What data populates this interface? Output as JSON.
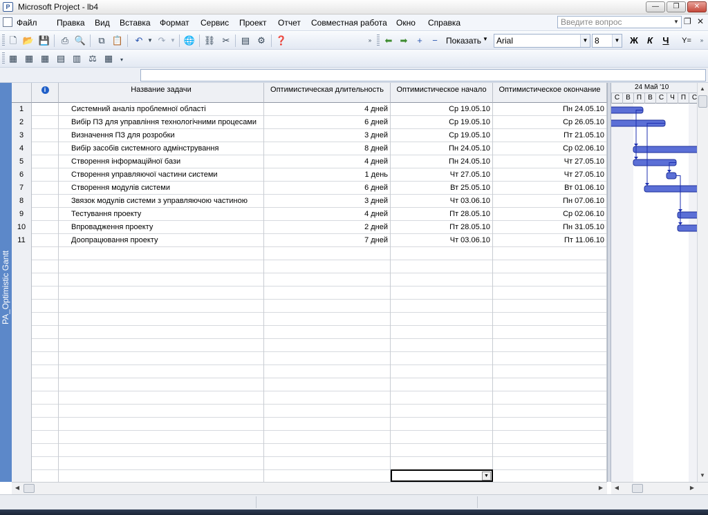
{
  "window": {
    "title": "Microsoft Project - lb4",
    "min_glyph": "—",
    "max_glyph": "❐",
    "close_glyph": "✕"
  },
  "menu": {
    "items": [
      "Файл",
      "Правка",
      "Вид",
      "Вставка",
      "Формат",
      "Сервис",
      "Проект",
      "Отчет",
      "Совместная работа",
      "Окно",
      "Справка"
    ],
    "help_placeholder": "Введите вопрос",
    "doc_restore_glyph": "❐",
    "doc_close_glyph": "✕"
  },
  "toolbar": {
    "show_label": "Показать",
    "font": "Arial",
    "font_size": "8",
    "bold_label": "Ж",
    "italic_label": "К",
    "underline_label": "Ч",
    "filter_label": "Y="
  },
  "view": {
    "label": "PA_Optimistic Gantt"
  },
  "table": {
    "headers": {
      "indicators": "i",
      "name": "Название задачи",
      "duration": "Оптимистическая длительность",
      "start": "Оптимистическое начало",
      "finish": "Оптимистическое окончание"
    },
    "rows": [
      {
        "id": "1",
        "name": "Системний аналіз проблемної області",
        "duration": "4 дней",
        "start": "Ср 19.05.10",
        "finish": "Пн 24.05.10"
      },
      {
        "id": "2",
        "name": "Вибір ПЗ для управління технологічними процесами",
        "duration": "6 дней",
        "start": "Ср 19.05.10",
        "finish": "Ср 26.05.10"
      },
      {
        "id": "3",
        "name": "Визначення ПЗ для розробки",
        "duration": "3 дней",
        "start": "Ср 19.05.10",
        "finish": "Пт 21.05.10"
      },
      {
        "id": "4",
        "name": "Вибір засобів системного адмінстрування",
        "duration": "8 дней",
        "start": "Пн 24.05.10",
        "finish": "Ср 02.06.10"
      },
      {
        "id": "5",
        "name": "Створення інформаційної бази",
        "duration": "4 дней",
        "start": "Пн 24.05.10",
        "finish": "Чт 27.05.10"
      },
      {
        "id": "6",
        "name": "Створення управляючої частини системи",
        "duration": "1 день",
        "start": "Чт 27.05.10",
        "finish": "Чт 27.05.10"
      },
      {
        "id": "7",
        "name": "Створення модулів системи",
        "duration": "6 дней",
        "start": "Вт 25.05.10",
        "finish": "Вт 01.06.10"
      },
      {
        "id": "8",
        "name": "Звязок модулів системи з управляючою частиною",
        "duration": "3 дней",
        "start": "Чт 03.06.10",
        "finish": "Пн 07.06.10"
      },
      {
        "id": "9",
        "name": "Тестування проекту",
        "duration": "4 дней",
        "start": "Пт 28.05.10",
        "finish": "Ср 02.06.10"
      },
      {
        "id": "10",
        "name": "Впровадження проекту",
        "duration": "2 дней",
        "start": "Пт 28.05.10",
        "finish": "Пн 31.05.10"
      },
      {
        "id": "11",
        "name": "Доопрацювання проекту",
        "duration": "7 дней",
        "start": "Чт 03.06.10",
        "finish": "Пт 11.06.10"
      }
    ]
  },
  "gantt": {
    "week_label": "24 Май '10",
    "days": [
      "С",
      "В",
      "П",
      "В",
      "С",
      "Ч",
      "П",
      "С"
    ],
    "bar_color": "#5b6fd6"
  }
}
